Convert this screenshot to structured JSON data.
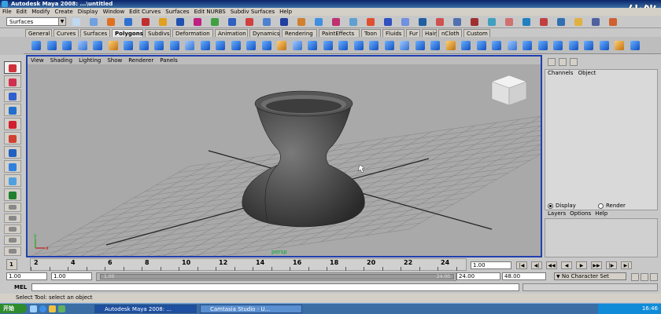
{
  "window": {
    "title": "Autodesk Maya 2008: ...\\untitled",
    "watermark": "伙伴"
  },
  "menubar": [
    "File",
    "Edit",
    "Modify",
    "Create",
    "Display",
    "Window",
    "Edit Curves",
    "Surfaces",
    "Edit NURBS",
    "Subdiv Surfaces",
    "Help"
  ],
  "status_line": {
    "menu_set": "Surfaces"
  },
  "shelf": {
    "tabs": [
      "General",
      "Curves",
      "Surfaces",
      "Polygons",
      "Subdivs",
      "Deformation",
      "Animation",
      "Dynamics",
      "Rendering",
      "PaintEffects",
      "Toon",
      "Fluids",
      "Fur",
      "Hair",
      "nCloth",
      "Custom"
    ],
    "active_tab": "Polygons"
  },
  "viewport": {
    "panel_menu": [
      "View",
      "Shading",
      "Lighting",
      "Show",
      "Renderer",
      "Panels"
    ],
    "camera": "persp",
    "axis_x": "x",
    "axis_y": "y"
  },
  "channel_box": {
    "menu": [
      "Channels",
      "Object"
    ]
  },
  "layer_editor": {
    "display_label": "Display",
    "render_label": "Render",
    "menu": [
      "Layers",
      "Options",
      "Help"
    ]
  },
  "time_slider": {
    "ticks": [
      "2",
      "4",
      "6",
      "8",
      "10",
      "12",
      "14",
      "16",
      "18",
      "20",
      "22",
      "24"
    ],
    "current_frame": "1.00",
    "current_time_marker": "1"
  },
  "range_slider": {
    "start_time": "1.00",
    "playback_start": "1.00",
    "range_start_label": "1.00",
    "range_end_label": "24.00",
    "playback_end": "24.00",
    "end_time": "48.00",
    "character_set": "No Character Set"
  },
  "command_line": {
    "label": "MEL"
  },
  "help_line": {
    "text": "Select Tool: select an object"
  },
  "taskbar": {
    "start": "开始",
    "items": [
      "Autodesk Maya 2008: ...",
      "Camtasia Studio - U..."
    ],
    "clock": "16:46"
  },
  "colors": {
    "viewport_border": "#1f3fb0",
    "viewport_bg": "#a9a9a9",
    "taskbar": "#3a6ea5"
  }
}
